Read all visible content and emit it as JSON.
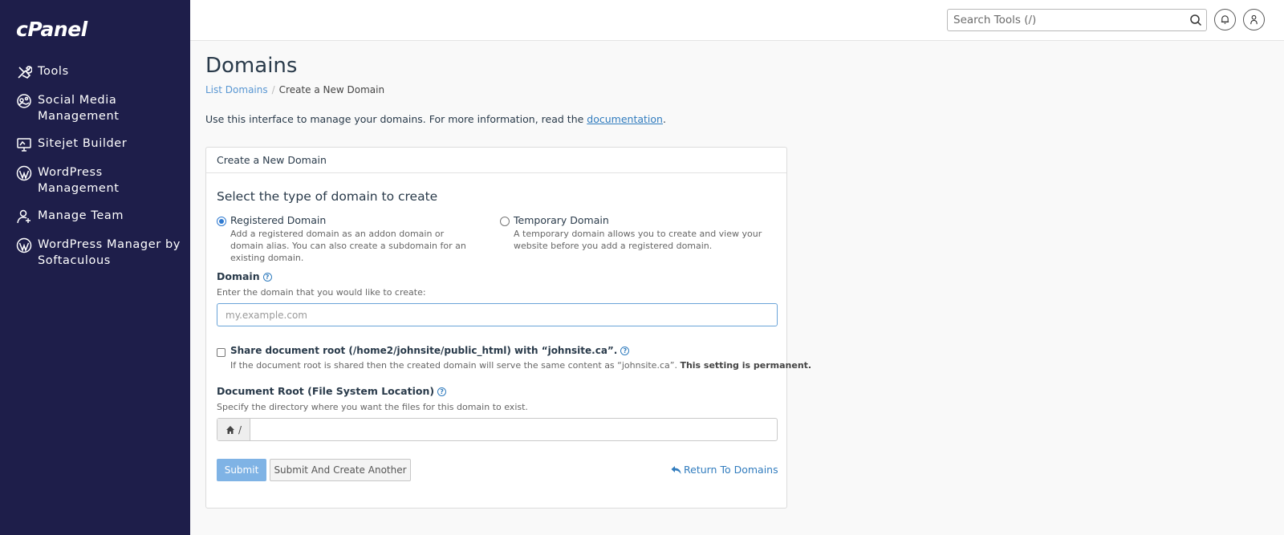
{
  "app": {
    "logo": "cPanel"
  },
  "sidebar": {
    "items": [
      {
        "label": "Tools",
        "icon": "tools-icon"
      },
      {
        "label": "Social Media Management",
        "icon": "social-media-icon"
      },
      {
        "label": "Sitejet Builder",
        "icon": "sitejet-icon"
      },
      {
        "label": "WordPress Management",
        "icon": "wordpress-icon"
      },
      {
        "label": "Manage Team",
        "icon": "manage-team-icon"
      },
      {
        "label": "WordPress Manager by Softaculous",
        "icon": "wordpress-icon"
      }
    ]
  },
  "topbar": {
    "search_placeholder": "Search Tools (/)",
    "icons": [
      "search-icon",
      "bell-icon",
      "user-icon"
    ]
  },
  "page": {
    "title": "Domains",
    "breadcrumb": {
      "link": "List Domains",
      "separator": "/",
      "current": "Create a New Domain"
    },
    "intro_text": "Use this interface to manage your domains. For more information, read the ",
    "intro_link": "documentation",
    "intro_end": "."
  },
  "panel": {
    "heading": "Create a New Domain",
    "section_title": "Select the type of domain to create",
    "options": [
      {
        "title": "Registered Domain",
        "description": "Add a registered domain as an addon domain or domain alias. You can also create a subdomain for an existing domain.",
        "selected": true
      },
      {
        "title": "Temporary Domain",
        "description": "A temporary domain allows you to create and view your website before you add a registered domain.",
        "selected": false
      }
    ],
    "domain": {
      "label": "Domain",
      "hint": "Enter the domain that you would like to create:",
      "placeholder": "my.example.com",
      "value": ""
    },
    "share": {
      "label": "Share document root (/home2/johnsite/public_html) with “johnsite.ca”.",
      "hint": "If the document root is shared then the created domain will serve the same content as “johnsite.ca”.",
      "hint_bold": "This setting is permanent.",
      "checked": false
    },
    "docroot": {
      "label": "Document Root (File System Location)",
      "hint": "Specify the directory where you want the files for this domain to exist.",
      "prefix": "/",
      "value": ""
    },
    "buttons": {
      "submit": "Submit",
      "submit_another": "Submit And Create Another",
      "return": "Return To Domains"
    }
  },
  "colors": {
    "sidebar_bg": "#1e1e4a",
    "accent": "#317cbe",
    "submit_bg": "#7fb3e5"
  }
}
